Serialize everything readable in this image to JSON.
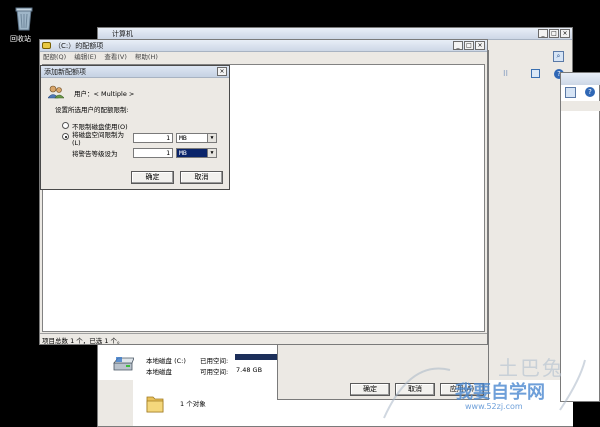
{
  "desktop": {
    "recycle_bin_label": "回收站"
  },
  "explorer_window": {
    "title": "计算机"
  },
  "quota_window": {
    "title": "（C:）的配额项",
    "menu": [
      "配额(Q)",
      "编辑(E)",
      "查看(V)",
      "帮助(H)"
    ],
    "status_text": "项目总数 1 个，已选 1 个。"
  },
  "add_quota_dialog": {
    "title": "添加新配额项",
    "user_label": "用户：< Multiple >",
    "instruction": "设置所选用户的配额限制:",
    "radio_no_limit": "不限制磁盘使用(O)",
    "radio_limit": "将磁盘空间限制为(L)",
    "warning_label": "将警告等级设为",
    "limit_value": "1",
    "limit_unit": "MB",
    "warning_value": "1",
    "warning_unit": "MB",
    "ok_label": "确定",
    "cancel_label": "取消"
  },
  "properties_dialog": {
    "ok_label": "确定",
    "cancel_label": "取消",
    "apply_label": "应用(A)"
  },
  "drive_info": {
    "drive_name_1": "本地磁盘 (C:)",
    "used_label": "已用空间:",
    "drive_name_2": "本地磁盘",
    "free_label": "可用空间:",
    "free_value": "7.48 GB"
  },
  "folder_area": {
    "count_text": "1 个对象"
  },
  "watermark": {
    "brand": "土巴兔",
    "site_name": "我要自学网",
    "url": "www.52zj.com"
  }
}
